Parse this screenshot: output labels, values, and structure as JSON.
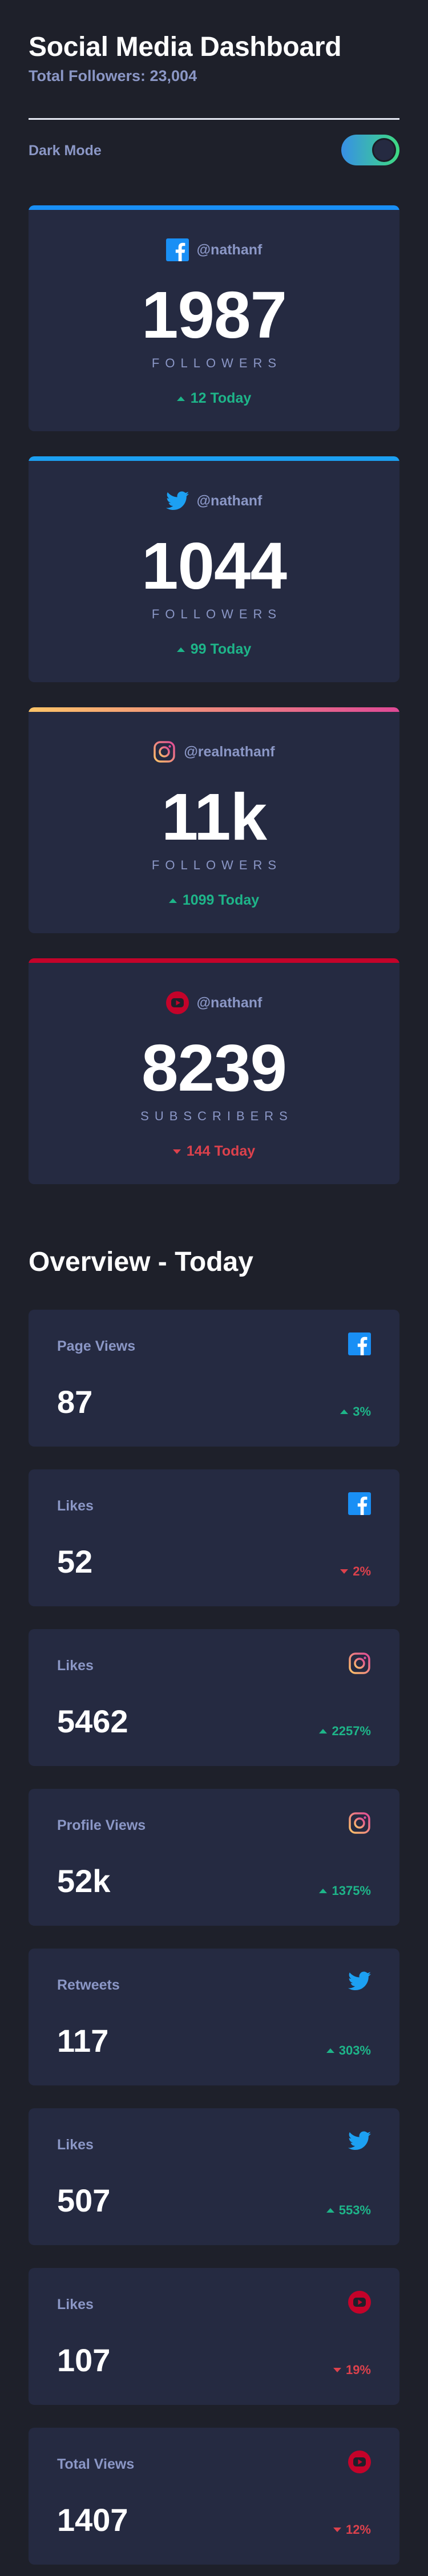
{
  "header": {
    "title": "Social Media Dashboard",
    "subtitle": "Total Followers: 23,004"
  },
  "theme": {
    "mode_label": "Dark Mode",
    "dark_mode_on": true
  },
  "colors": {
    "facebook": "#198ff5",
    "twitter": "#1ca0f2",
    "instagram_from": "#fdc468",
    "instagram_to": "#df4996",
    "youtube": "#c4032a",
    "up": "#1eb589",
    "down": "#dc414c"
  },
  "cards": [
    {
      "platform": "facebook",
      "icon": "facebook-icon",
      "handle": "@nathanf",
      "count": "1987",
      "unit": "FOLLOWERS",
      "delta": "12 Today",
      "trend": "up"
    },
    {
      "platform": "twitter",
      "icon": "twitter-icon",
      "handle": "@nathanf",
      "count": "1044",
      "unit": "FOLLOWERS",
      "delta": "99 Today",
      "trend": "up"
    },
    {
      "platform": "instagram",
      "icon": "instagram-icon",
      "handle": "@realnathanf",
      "count": "11k",
      "unit": "FOLLOWERS",
      "delta": "1099 Today",
      "trend": "up"
    },
    {
      "platform": "youtube",
      "icon": "youtube-icon",
      "handle": "@nathanf",
      "count": "8239",
      "unit": "SUBSCRIBERS",
      "delta": "144 Today",
      "trend": "down"
    }
  ],
  "overview": {
    "title": "Overview - Today",
    "items": [
      {
        "label": "Page Views",
        "platform": "facebook",
        "icon": "facebook-icon",
        "value": "87",
        "delta": "3%",
        "trend": "up"
      },
      {
        "label": "Likes",
        "platform": "facebook",
        "icon": "facebook-icon",
        "value": "52",
        "delta": "2%",
        "trend": "down"
      },
      {
        "label": "Likes",
        "platform": "instagram",
        "icon": "instagram-icon",
        "value": "5462",
        "delta": "2257%",
        "trend": "up"
      },
      {
        "label": "Profile Views",
        "platform": "instagram",
        "icon": "instagram-icon",
        "value": "52k",
        "delta": "1375%",
        "trend": "up"
      },
      {
        "label": "Retweets",
        "platform": "twitter",
        "icon": "twitter-icon",
        "value": "117",
        "delta": "303%",
        "trend": "up"
      },
      {
        "label": "Likes",
        "platform": "twitter",
        "icon": "twitter-icon",
        "value": "507",
        "delta": "553%",
        "trend": "up"
      },
      {
        "label": "Likes",
        "platform": "youtube",
        "icon": "youtube-icon",
        "value": "107",
        "delta": "19%",
        "trend": "down"
      },
      {
        "label": "Total Views",
        "platform": "youtube",
        "icon": "youtube-icon",
        "value": "1407",
        "delta": "12%",
        "trend": "down"
      }
    ]
  }
}
